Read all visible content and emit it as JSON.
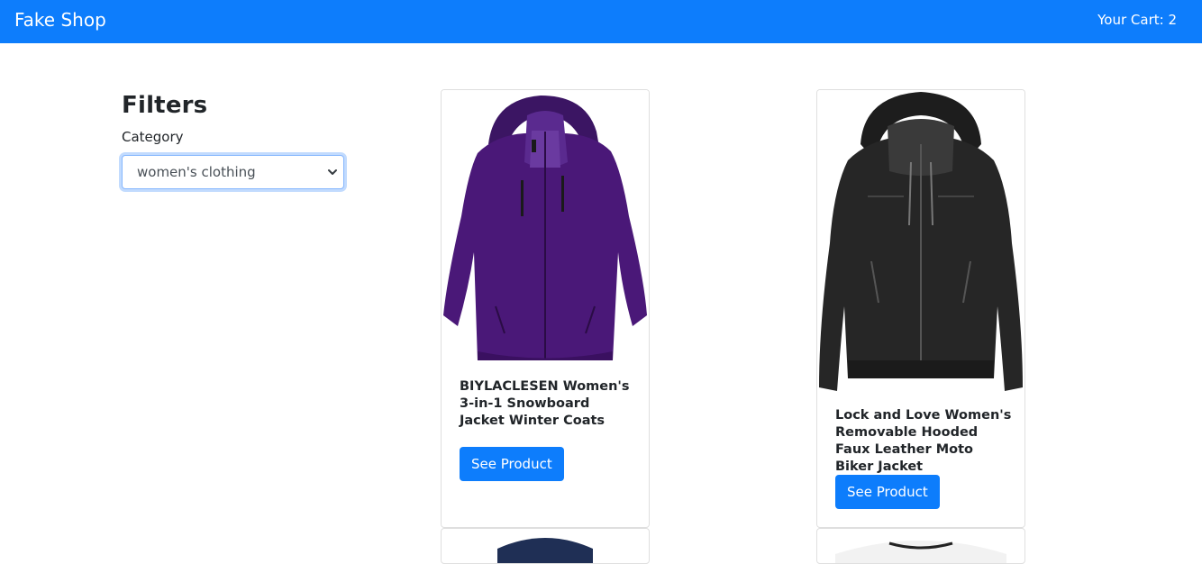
{
  "navbar": {
    "brand": "Fake Shop",
    "cart_label": "Your Cart: 2",
    "color": "#0d7dfc"
  },
  "filters": {
    "heading": "Filters",
    "category_label": "Category",
    "category_selected": "women's clothing"
  },
  "products": [
    {
      "title": "BIYLACLESEN Women's 3-in-1 Snowboard Jacket Winter Coats",
      "button": "See Product",
      "image_icon": "purple-jacket-image"
    },
    {
      "title": "Lock and Love Women's Removable Hooded Faux Leather Moto Biker Jacket",
      "button": "See Product",
      "image_icon": "black-leather-jacket-image"
    }
  ],
  "accent_color": "#0d7dfc"
}
